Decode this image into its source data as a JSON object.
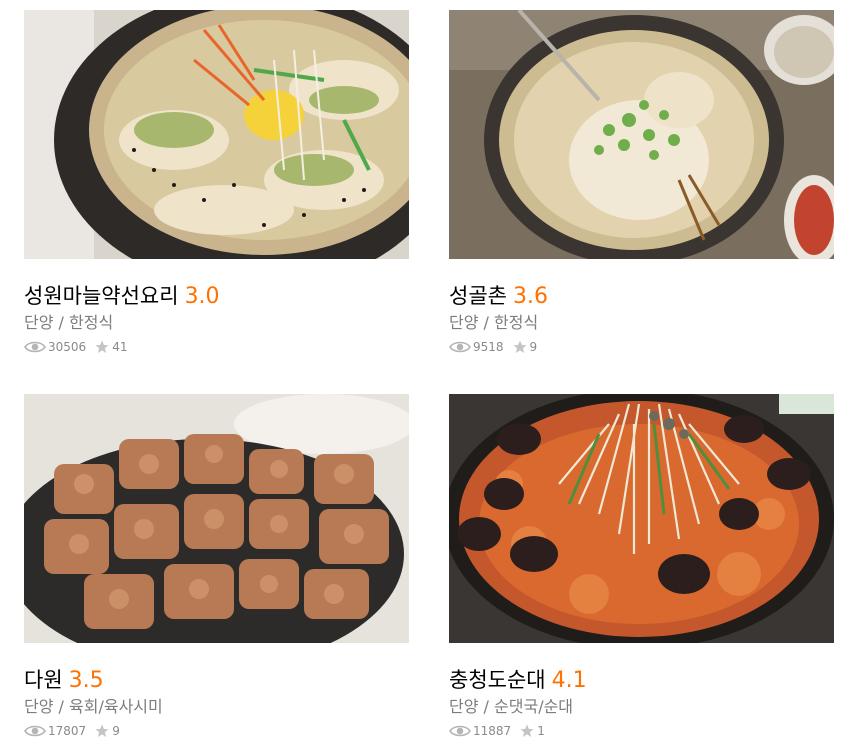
{
  "restaurants": [
    {
      "name": "성원마늘약선요리",
      "score": "3.0",
      "area": "단양",
      "category": "한정식",
      "views": "30506",
      "reviews": "41",
      "photo_icon": "boiled-pork-platter-photo"
    },
    {
      "name": "성골촌",
      "score": "3.6",
      "area": "단양",
      "category": "한정식",
      "views": "9518",
      "reviews": "9",
      "photo_icon": "chicken-soup-pot-photo"
    },
    {
      "name": "다원",
      "score": "3.5",
      "area": "단양",
      "category": "육회/육사시미",
      "views": "17807",
      "reviews": "9",
      "photo_icon": "grilled-meat-cubes-photo"
    },
    {
      "name": "충청도순대",
      "score": "4.1",
      "area": "단양",
      "category": "순댓국/순대",
      "views": "11887",
      "reviews": "1",
      "photo_icon": "sundae-hotpot-photo"
    }
  ],
  "separator": "/",
  "colors": {
    "score": "#ff7100",
    "subtext": "#7d7d7d",
    "stats": "#8a8a8a"
  }
}
